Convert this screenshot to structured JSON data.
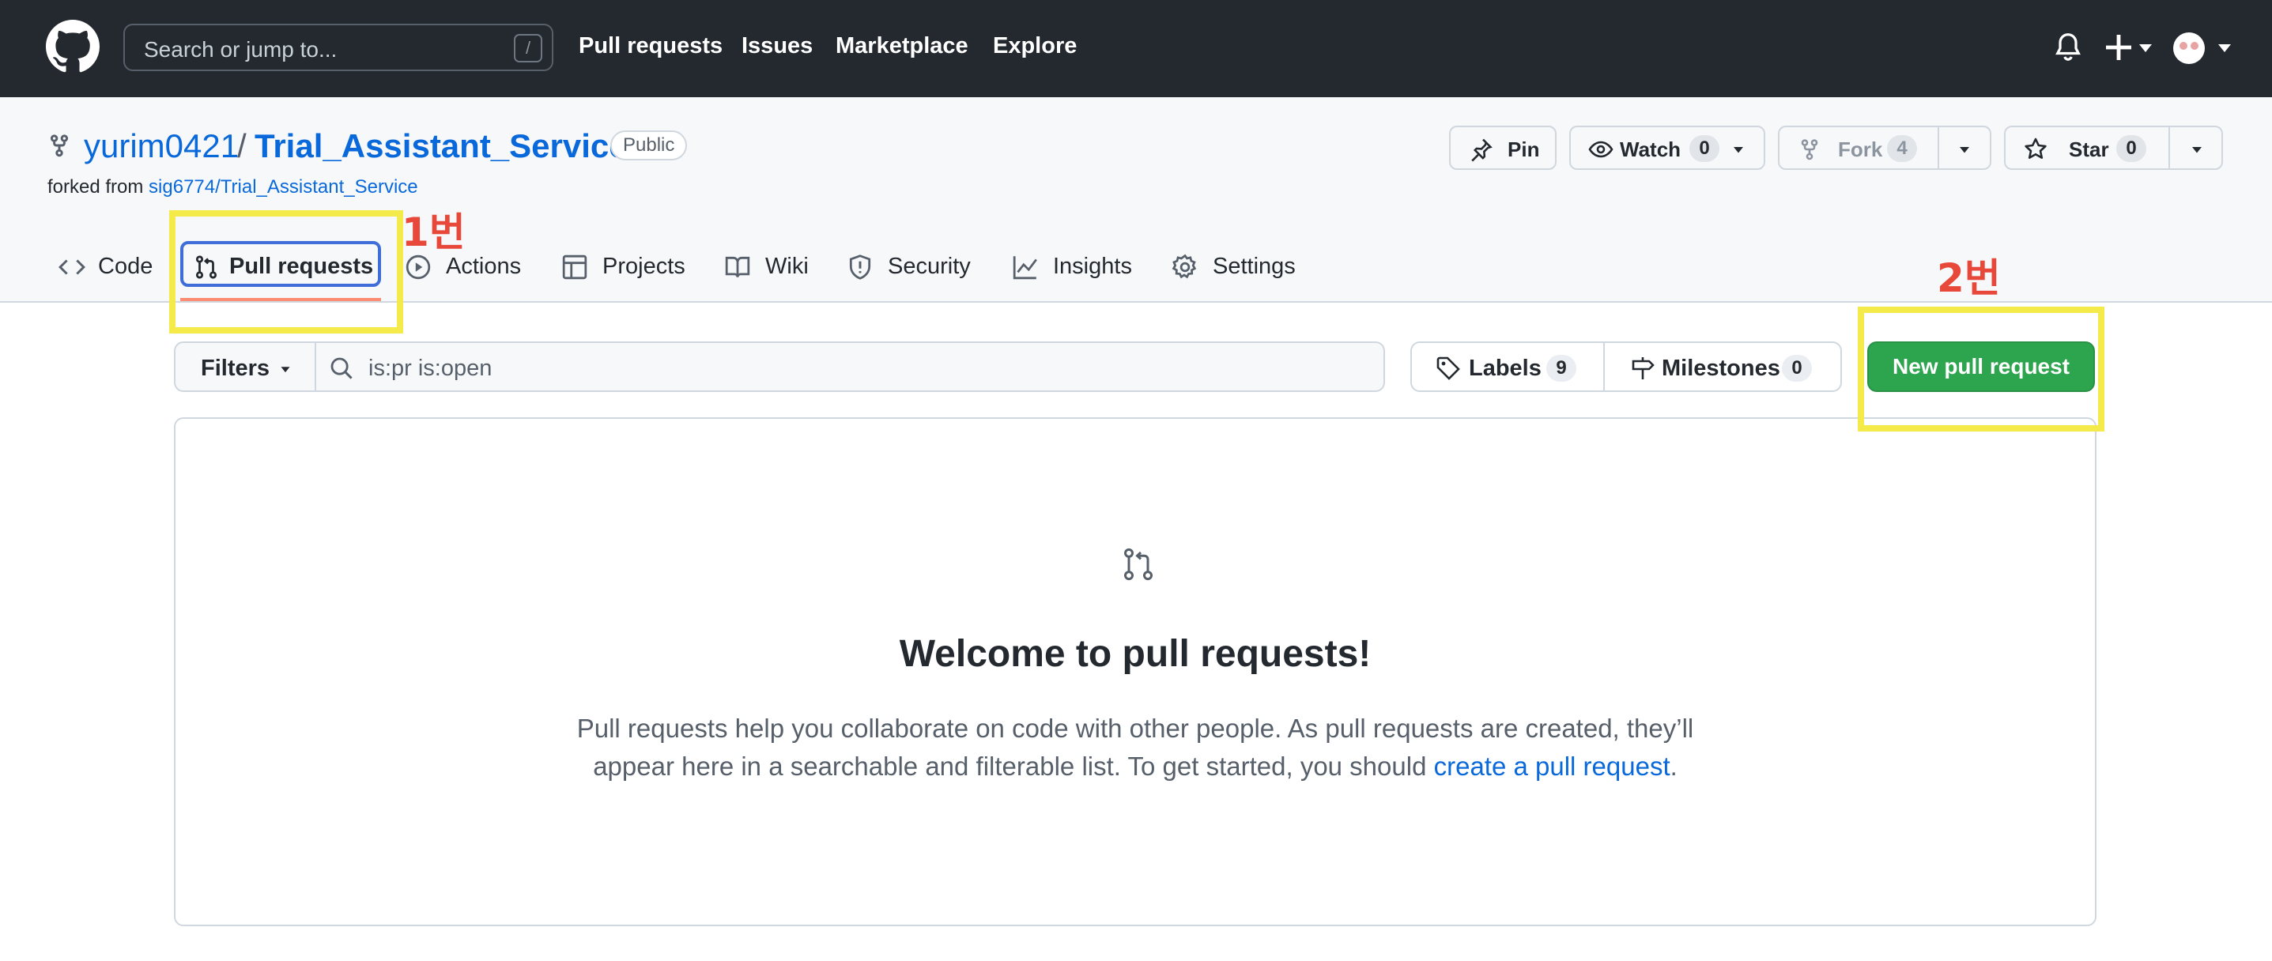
{
  "header": {
    "search_placeholder": "Search or jump to...",
    "search_shortcut": "/",
    "nav": [
      "Pull requests",
      "Issues",
      "Marketplace",
      "Explore"
    ]
  },
  "repo": {
    "owner": "yurim0421",
    "slash": "/",
    "name": "Trial_Assistant_Service",
    "visibility": "Public",
    "forked_from_prefix": "forked from",
    "forked_from": "sig6774/Trial_Assistant_Service",
    "actions": {
      "pin": "Pin",
      "watch": "Watch",
      "watch_count": "0",
      "fork": "Fork",
      "fork_count": "4",
      "star": "Star",
      "star_count": "0"
    }
  },
  "tabs": [
    "Code",
    "Pull requests",
    "Actions",
    "Projects",
    "Wiki",
    "Security",
    "Insights",
    "Settings"
  ],
  "toolbar": {
    "filters": "Filters",
    "query": "is:pr is:open",
    "labels": "Labels",
    "labels_count": "9",
    "milestones": "Milestones",
    "milestones_count": "0",
    "new_pr": "New pull request"
  },
  "blankslate": {
    "title": "Welcome to pull requests!",
    "desc_line1": "Pull requests help you collaborate on code with other people. As pull requests are created, they’ll",
    "desc_line2_prefix": "appear here in a searchable and filterable list. To get started, you should ",
    "desc_link": "create a pull request",
    "desc_suffix": "."
  },
  "annotations": {
    "step1": "1번",
    "step2": "2번",
    "highlight_color": "#f4ea4a",
    "label_color": "#e8483a"
  },
  "colors": {
    "header_bg": "#24292f",
    "link": "#0969da",
    "primary_button": "#2da44e",
    "active_tab_underline": "#fd8c73"
  }
}
